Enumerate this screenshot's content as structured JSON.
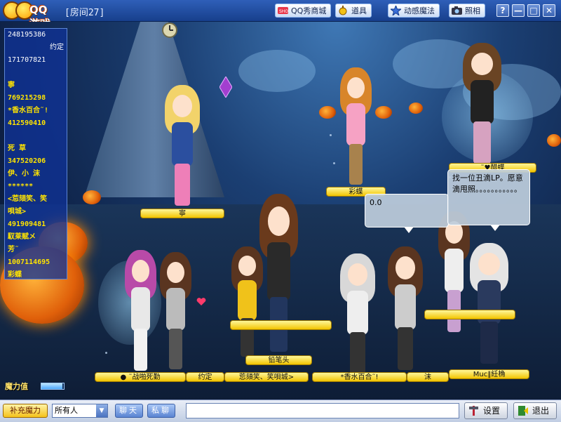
{
  "titlebar": {
    "logo_text": "QQ游戏",
    "room": "[房间27]",
    "buttons": {
      "shop": "QQ秀商城",
      "props": "道具",
      "magic": "动感魔法",
      "photo": "照相"
    },
    "window": {
      "help": "?",
      "minimize": "—",
      "maximize": "□",
      "close": "✕"
    }
  },
  "userlist": [
    {
      "text": "248195386",
      "style": "white"
    },
    {
      "text": "约定",
      "style": "white right"
    },
    {
      "text": "171707821",
      "style": "white"
    },
    {
      "text": "",
      "style": "white"
    },
    {
      "text": "寧",
      "style": "yellow"
    },
    {
      "text": "769215298",
      "style": "yellow"
    },
    {
      "text": "*香水百合˜!",
      "style": "yellow"
    },
    {
      "text": "412590410",
      "style": "yellow"
    },
    {
      "text": "",
      "style": "yellow"
    },
    {
      "text": "死 草",
      "style": "yellow"
    },
    {
      "text": "347520206",
      "style": "yellow"
    },
    {
      "text": "伊、小 沫",
      "style": "yellow"
    },
    {
      "text": "******",
      "style": "yellow"
    },
    {
      "text": "<莣頦笑、笑",
      "style": "yellow"
    },
    {
      "text": "唄城>",
      "style": "yellow"
    },
    {
      "text": "491909481",
      "style": "yellow"
    },
    {
      "text": "馭莱赋メ",
      "style": "yellow"
    },
    {
      "text": "芳˜",
      "style": "yellow"
    },
    {
      "text": "1007114695",
      "style": "yellow"
    },
    {
      "text": "彩蝶",
      "style": "yellow"
    }
  ],
  "plates": {
    "ning": "寧",
    "caidie": "彩蝶",
    "heart": "˜♥醋蝶",
    "pencil": "铅笔头",
    "bottom1": "●  ˜战啪死勤",
    "bottom2": "约定",
    "bottom3": "莣頦笑、笑唄城>",
    "bottom4": "*香水百合˜!",
    "bottom5": "沫",
    "bottom6": "Muc‖紝桷"
  },
  "bubbles": {
    "left": "0.0",
    "right": "找一位丑滴LP。愿意滴甩照。。。。。。。。。。。"
  },
  "mana": {
    "label": "魔力值",
    "fill": 0.95
  },
  "bottombar": {
    "refill": "补充魔力",
    "target": "所有人",
    "chat": "聊天",
    "private": "私聊",
    "input_value": "",
    "settings": "设置",
    "exit": "退出"
  },
  "icons": [
    "qq-logo-icon",
    "show-shop-icon",
    "props-icon",
    "magic-star-icon",
    "camera-icon",
    "settings-icon",
    "exit-icon"
  ]
}
